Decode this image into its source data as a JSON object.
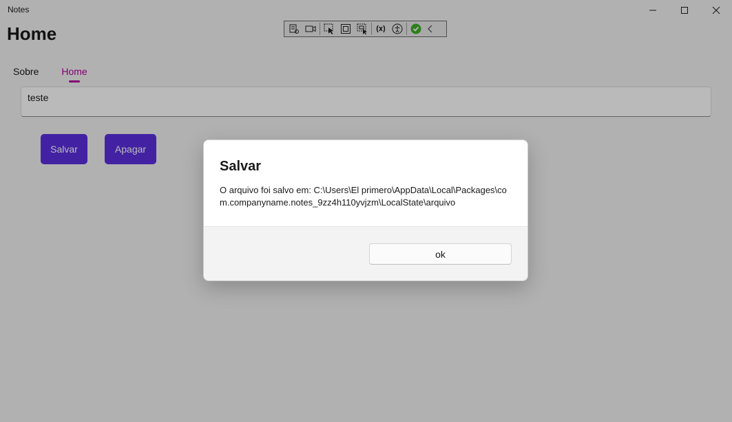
{
  "window": {
    "title": "Notes",
    "controls": {
      "minimize": "minimize-icon",
      "maximize": "maximize-icon",
      "close": "close-icon"
    }
  },
  "page": {
    "heading": "Home"
  },
  "debug_toolbar": {
    "icons": [
      "live-visual-tree-icon",
      "record-icon",
      "select-element-icon",
      "display-layout-adorners-icon",
      "track-focus-icon",
      "binding-failures-icon",
      "accessibility-icon",
      "hot-reload-ok-icon",
      "collapse-chevron-icon"
    ],
    "status_color": "#3fae29"
  },
  "tabs": [
    {
      "label": "Sobre",
      "active": false
    },
    {
      "label": "Home",
      "active": true
    }
  ],
  "editor": {
    "value": "teste"
  },
  "actions": {
    "save_label": "Salvar",
    "delete_label": "Apagar"
  },
  "colors": {
    "accent": "#b4009e",
    "button_primary": "#5b2fe0",
    "overlay": "rgba(0,0,0,0.27)"
  },
  "dialog": {
    "title": "Salvar",
    "message": "O arquivo foi salvo em: C:\\Users\\El primero\\AppData\\Local\\Packages\\com.companyname.notes_9zz4h110yvjzm\\LocalState\\arquivo",
    "ok_label": "ok"
  }
}
